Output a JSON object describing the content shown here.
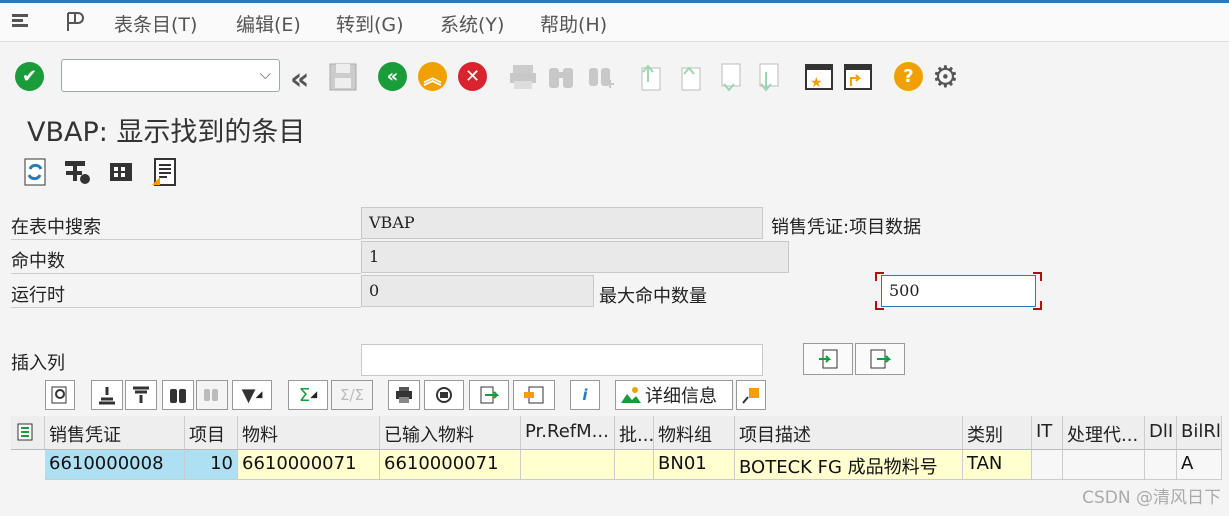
{
  "menu": {
    "items": [
      "表条目(T)",
      "编辑(E)",
      "转到(G)",
      "系统(Y)",
      "帮助(H)"
    ]
  },
  "colors": {
    "green": "#1a9c3a",
    "orange": "#f0a000",
    "red": "#d9232e",
    "key": "#aee0f4",
    "yellow": "#ffffd0"
  },
  "page": {
    "title": "VBAP: 显示找到的条目"
  },
  "fields": {
    "search_label": "在表中搜索",
    "search_value": "VBAP",
    "search_desc": "销售凭证:项目数据",
    "hits_label": "命中数",
    "hits_value": "1",
    "runtime_label": "运行时",
    "runtime_value": "0",
    "maxhits_label": "最大命中数量",
    "maxhits_value": "500",
    "insert_label": "插入列"
  },
  "grid_toolbar": {
    "details_label": "详细信息",
    "sum_icon": "Σ"
  },
  "table": {
    "headers": [
      "销售凭证",
      "项目",
      "物料",
      "已输入物料",
      "Pr.RefM...",
      "批...",
      "物料组",
      "项目描述",
      "类别",
      "IT",
      "处理代...",
      "DlI",
      "BilRl"
    ],
    "rows": [
      [
        "6610000008",
        "10",
        "6610000071",
        "6610000071",
        "",
        "",
        "BN01",
        "BOTECK FG 成品物料号",
        "TAN",
        "",
        "",
        "",
        "A"
      ]
    ]
  },
  "watermark": "CSDN @清风日下"
}
